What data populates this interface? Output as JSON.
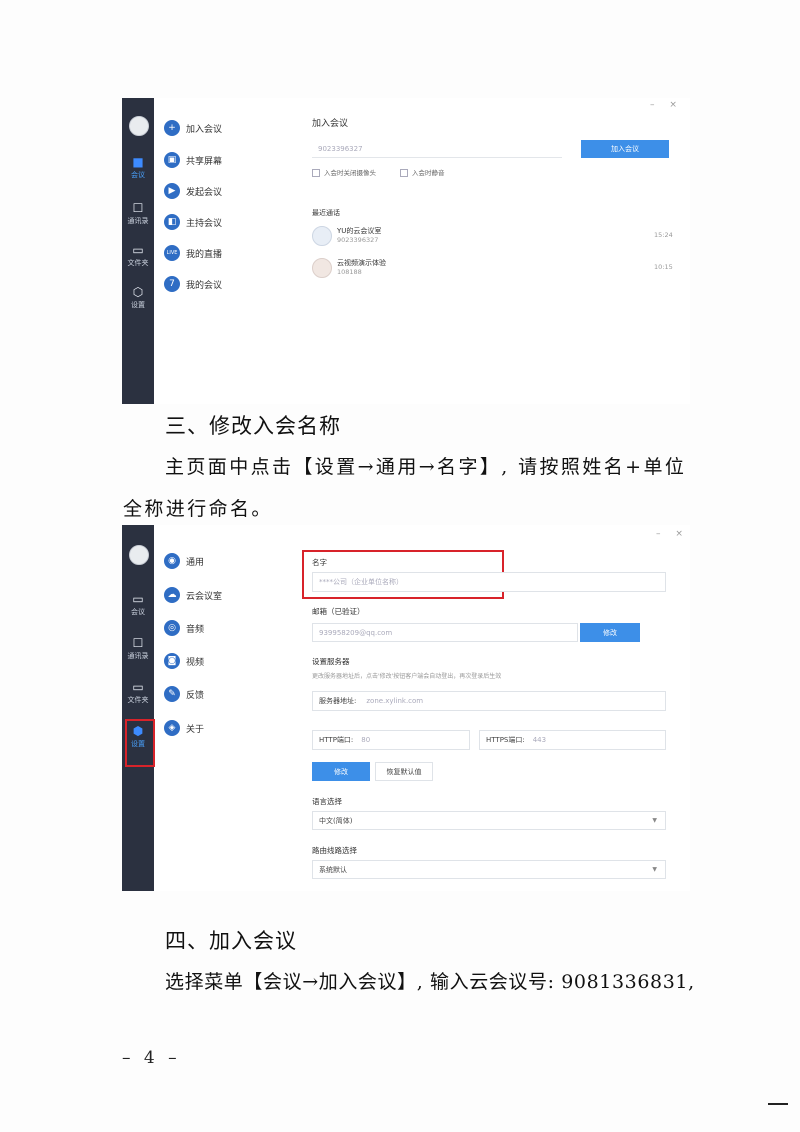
{
  "shot1": {
    "rail": [
      "会议",
      "通讯录",
      "文件夹",
      "设置"
    ],
    "menu": [
      {
        "icon": "+",
        "label": "加入会议"
      },
      {
        "icon": "▣",
        "label": "共享屏幕"
      },
      {
        "icon": "▶",
        "label": "发起会议"
      },
      {
        "icon": "◧",
        "label": "主持会议"
      },
      {
        "icon": "LIVE",
        "label": "我的直播"
      },
      {
        "icon": "7",
        "label": "我的会议"
      }
    ],
    "window_controls": "– ×",
    "panel_title": "加入会议",
    "meeting_id_value": "9023396327",
    "join_button": "加入会议",
    "option_camera": "入会时关闭摄像头",
    "option_mute": "入会时静音",
    "recent_title": "最近通话",
    "recent": [
      {
        "name": "YU的云会议室",
        "id": "9023396327",
        "time": "15:24"
      },
      {
        "name": "云视频演示体验",
        "id": "108188",
        "time": "10:15"
      }
    ]
  },
  "section3": {
    "heading": "三、修改入会名称",
    "line1": "主页面中点击【设置→通用→名字】, 请按照姓名+单位",
    "line2": "全称进行命名。"
  },
  "shot2": {
    "rail": [
      "会议",
      "通讯录",
      "文件夹",
      "设置"
    ],
    "menu": [
      {
        "icon": "◉",
        "label": "通用"
      },
      {
        "icon": "☁",
        "label": "云会议室"
      },
      {
        "icon": "◎",
        "label": "音频"
      },
      {
        "icon": "◙",
        "label": "视频"
      },
      {
        "icon": "✎",
        "label": "反馈"
      },
      {
        "icon": "◈",
        "label": "关于"
      }
    ],
    "window_controls": "– ×",
    "name_label": "名字",
    "name_placeholder": "****公司（企业单位名称）",
    "email_label": "邮箱（已验证）",
    "email_value": "939958209@qq.com",
    "email_button": "修改",
    "server_title": "设置服务器",
    "server_hint": "更改服务器地址后，点击'修改'按钮客户端会自动登出，再次登录后生效",
    "server_addr_label": "服务器地址:",
    "server_addr_value": "zone.xylink.com",
    "http_label": "HTTP端口:",
    "http_value": "80",
    "https_label": "HTTPS端口:",
    "https_value": "443",
    "modify_button": "修改",
    "restore_button": "恢复默认值",
    "lang_label": "语言选择",
    "lang_value": "中文(简体)",
    "route_label": "路由线路选择",
    "route_value": "系统默认"
  },
  "section4": {
    "heading": "四、加入会议",
    "line1": "选择菜单【会议→加入会议】, 输入云会议号: 9081336831,"
  },
  "page_number": "– 4 –"
}
